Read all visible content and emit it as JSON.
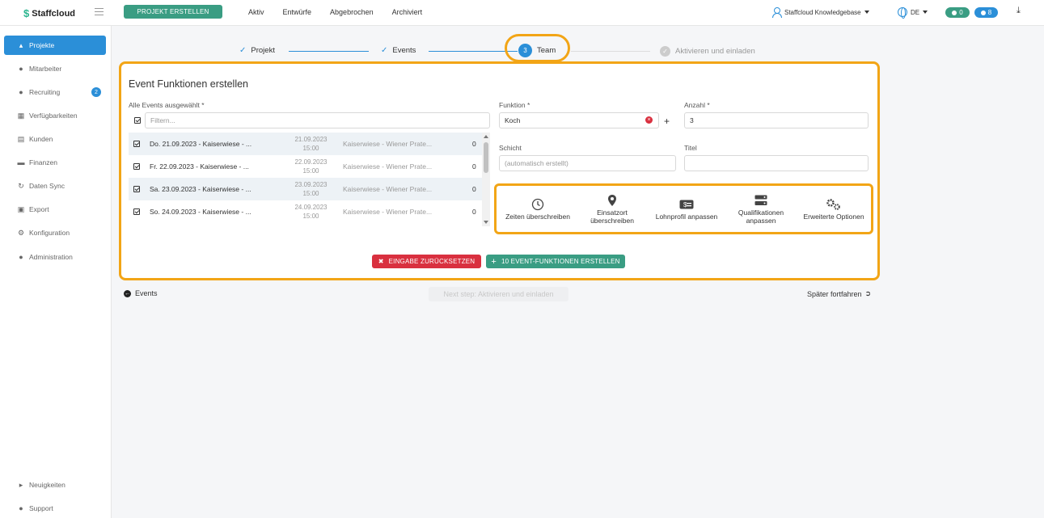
{
  "app": {
    "name": "Staffcloud"
  },
  "topbar": {
    "create_button": "PROJEKT ERSTELLEN",
    "nav": [
      "Aktiv",
      "Entwürfe",
      "Abgebrochen",
      "Archiviert"
    ],
    "account": "Staffcloud Knowledgebase",
    "language": "DE",
    "badge_green": "0",
    "badge_blue": "8"
  },
  "sidebar": {
    "items": [
      {
        "label": "Projekte",
        "icon": "sitemap-icon",
        "active": true
      },
      {
        "label": "Mitarbeiter",
        "icon": "users-icon"
      },
      {
        "label": "Recruiting",
        "icon": "user-plus-icon",
        "badge": "2"
      },
      {
        "label": "Verfügbarkeiten",
        "icon": "calendar-icon"
      },
      {
        "label": "Kunden",
        "icon": "building-icon"
      },
      {
        "label": "Finanzen",
        "icon": "money-icon"
      },
      {
        "label": "Daten Sync",
        "icon": "sync-icon"
      },
      {
        "label": "Export",
        "icon": "file-icon"
      },
      {
        "label": "Konfiguration",
        "icon": "gear-icon"
      },
      {
        "label": "Administration",
        "icon": "user-gear-icon"
      }
    ],
    "bottom": [
      {
        "label": "Neuigkeiten",
        "icon": "megaphone-icon"
      },
      {
        "label": "Support",
        "icon": "comments-icon"
      }
    ]
  },
  "stepper": {
    "steps": [
      {
        "label": "Projekt",
        "state": "done"
      },
      {
        "label": "Events",
        "state": "done"
      },
      {
        "label": "Team",
        "state": "current",
        "number": "3"
      },
      {
        "label": "Aktivieren und einladen",
        "state": "pending"
      }
    ]
  },
  "form": {
    "title": "Event Funktionen erstellen",
    "events_label": "Alle Events ausgewählt *",
    "filter_placeholder": "Filtern...",
    "events": [
      {
        "name": "Do. 21.09.2023 - Kaiserwiese - ...",
        "date": "21.09.2023",
        "time": "15:00",
        "place": "Kaiserwiese - Wiener Prate...",
        "count": "0"
      },
      {
        "name": "Fr. 22.09.2023 - Kaiserwiese - ...",
        "date": "22.09.2023",
        "time": "15:00",
        "place": "Kaiserwiese - Wiener Prate...",
        "count": "0"
      },
      {
        "name": "Sa. 23.09.2023 - Kaiserwiese - ...",
        "date": "23.09.2023",
        "time": "15:00",
        "place": "Kaiserwiese - Wiener Prate...",
        "count": "0"
      },
      {
        "name": "So. 24.09.2023 - Kaiserwiese - ...",
        "date": "24.09.2023",
        "time": "15:00",
        "place": "Kaiserwiese - Wiener Prate...",
        "count": "0"
      }
    ],
    "funktion_label": "Funktion *",
    "funktion_value": "Koch",
    "anzahl_label": "Anzahl *",
    "anzahl_value": "3",
    "schicht_label": "Schicht",
    "schicht_placeholder": "(automatisch erstellt)",
    "titel_label": "Titel",
    "options": [
      {
        "label": "Zeiten überschreiben",
        "icon": "clock-icon"
      },
      {
        "label": "Einsatzort überschreiben",
        "icon": "map-marker-icon"
      },
      {
        "label": "Lohnprofil anpassen",
        "icon": "money-bill-icon"
      },
      {
        "label": "Qualifikationen anpassen",
        "icon": "server-icon"
      },
      {
        "label": "Erweiterte Optionen",
        "icon": "cogs-icon"
      }
    ],
    "reset_button": "EINGABE ZURÜCKSETZEN",
    "submit_button": "10 EVENT-FUNKTIONEN ERSTELLEN"
  },
  "footer_nav": {
    "back": "Events",
    "next": "Next step: Aktivieren und einladen",
    "later": "Später fortfahren"
  },
  "colors": {
    "primary": "#2b8fd8",
    "green": "#3a9d83",
    "danger": "#d9303f",
    "highlight": "#f2a516"
  }
}
